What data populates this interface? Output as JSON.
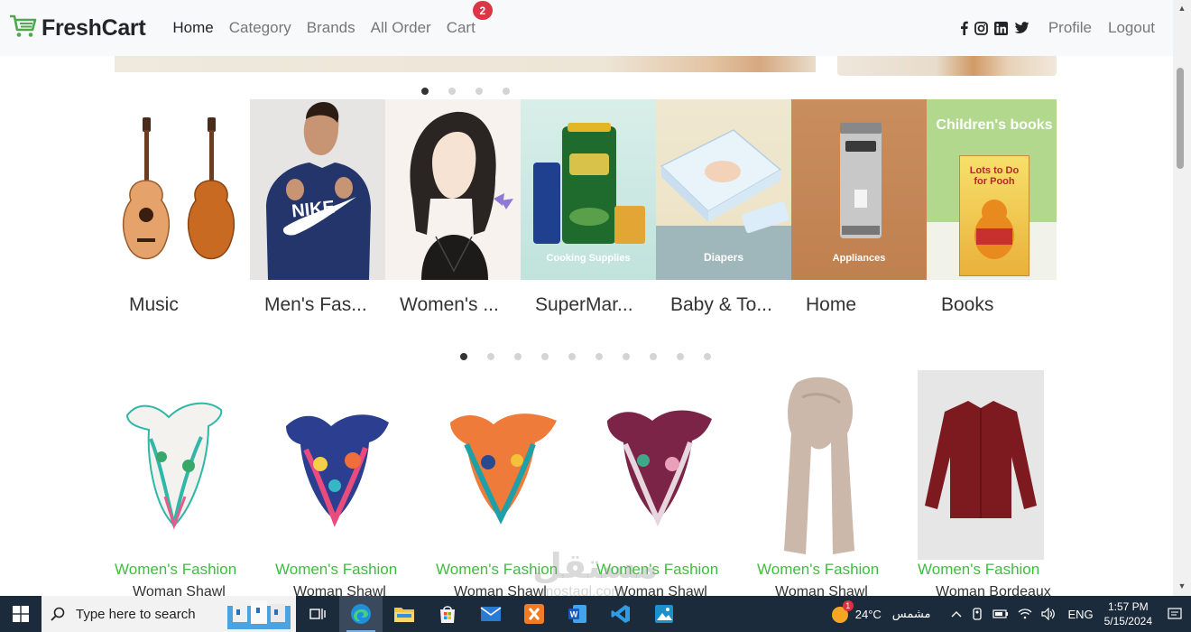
{
  "navbar": {
    "brand": "FreshCart",
    "links": [
      {
        "label": "Home",
        "active": true
      },
      {
        "label": "Category"
      },
      {
        "label": "Brands"
      },
      {
        "label": "All Order"
      },
      {
        "label": "Cart",
        "badge": "2"
      }
    ],
    "social": [
      "facebook-icon",
      "instagram-icon",
      "linkedin-icon",
      "twitter-icon"
    ],
    "profile": "Profile",
    "logout": "Logout"
  },
  "banner_dots": {
    "count": 4,
    "active": 0
  },
  "categories": [
    {
      "name": "Music",
      "image": "guitar"
    },
    {
      "name": "Men's Fas...",
      "image": "nike-hoodie"
    },
    {
      "name": "Women's ...",
      "image": "illustrated-woman"
    },
    {
      "name": "SuperMar...",
      "image": "cooking-supplies",
      "caption": "Cooking Supplies"
    },
    {
      "name": "Baby & To...",
      "image": "diapers",
      "caption": "Diapers"
    },
    {
      "name": "Home",
      "image": "coffee-machine",
      "caption": "Appliances"
    },
    {
      "name": "Books",
      "image": "childrens-book",
      "caption": "Children's books",
      "book_title": "Lots to Do for Pooh"
    }
  ],
  "category_dots": {
    "count": 10,
    "active": 0
  },
  "products": [
    {
      "category": "Women's Fashion",
      "title": "Woman Shawl"
    },
    {
      "category": "Women's Fashion",
      "title": "Woman Shawl"
    },
    {
      "category": "Women's Fashion",
      "title": "Woman Shawl"
    },
    {
      "category": "Women's Fashion",
      "title": "Woman Shawl"
    },
    {
      "category": "Women's Fashion",
      "title": "Woman Shawl"
    },
    {
      "category": "Women's Fashion",
      "title": "Woman Bordeaux"
    }
  ],
  "watermark": {
    "text": "مستقل",
    "sub": "mostaql.com"
  },
  "taskbar": {
    "search_placeholder": "Type here to search",
    "weather_temp": "24°C",
    "weather_desc": "مشمس",
    "weather_badge": "1",
    "language": "ENG",
    "time": "1:57 PM",
    "date": "5/15/2024"
  },
  "colors": {
    "brand_green": "#4fa74f",
    "category_text": "#3fbd3f",
    "badge_red": "#dc3545",
    "taskbar": "#1c2b3b"
  }
}
